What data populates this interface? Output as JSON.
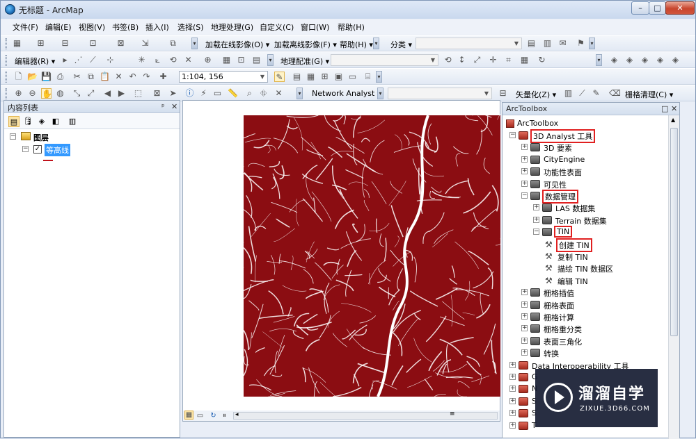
{
  "window": {
    "title": "无标题 - ArcMap",
    "minimize": "–",
    "maximize": "□",
    "close": "✕"
  },
  "menu": [
    "文件(F)",
    "编辑(E)",
    "视图(V)",
    "书签(B)",
    "插入(I)",
    "选择(S)",
    "地理处理(G)",
    "自定义(C)",
    "窗口(W)",
    "帮助(H)"
  ],
  "toolbar1": {
    "add_online_imagery": "加载在线影像(O) ▾",
    "add_offline_imagery": "加载离线影像(F) ▾",
    "help": "帮助(H) ▾",
    "classify": "分类 ▾"
  },
  "toolbar2": {
    "editor": "编辑器(R) ▾",
    "georeferencing": "地理配准(G) ▾"
  },
  "toolbar3": {
    "scale": "1:104, 156"
  },
  "toolbar4": {
    "network_analyst": "Network Analyst ▾",
    "vectorize": "矢量化(Z) ▾",
    "raster_cleanup": "栅格清理(C) ▾"
  },
  "toc": {
    "title": "内容列表",
    "pin": "ᵖ",
    "close": "✕",
    "root": "图层",
    "layer": "等高线"
  },
  "map": {
    "colors": {
      "contour_fill": "#8b0d12",
      "contour_line": "#ffffff"
    }
  },
  "toolbox": {
    "title": "ArcToolbox",
    "root": "ArcToolbox",
    "items": [
      {
        "label": "3D Analyst 工具",
        "level": 0,
        "expander": "−",
        "icon": "toolbox-icon",
        "highlight": true
      },
      {
        "label": "3D 要素",
        "level": 1,
        "expander": "+",
        "icon": "toolset-icon"
      },
      {
        "label": "CityEngine",
        "level": 1,
        "expander": "+",
        "icon": "toolset-icon"
      },
      {
        "label": "功能性表面",
        "level": 1,
        "expander": "+",
        "icon": "toolset-icon"
      },
      {
        "label": "可见性",
        "level": 1,
        "expander": "+",
        "icon": "toolset-icon"
      },
      {
        "label": "数据管理",
        "level": 1,
        "expander": "−",
        "icon": "toolset-icon",
        "highlight": true
      },
      {
        "label": "LAS 数据集",
        "level": 2,
        "expander": "+",
        "icon": "toolset-icon"
      },
      {
        "label": "Terrain 数据集",
        "level": 2,
        "expander": "+",
        "icon": "toolset-icon"
      },
      {
        "label": "TIN",
        "level": 2,
        "expander": "−",
        "icon": "toolset-icon",
        "highlight": true
      },
      {
        "label": "创建 TIN",
        "level": 3,
        "expander": "",
        "icon": "hammer-icon",
        "highlight": true
      },
      {
        "label": "复制 TIN",
        "level": 3,
        "expander": "",
        "icon": "hammer-icon"
      },
      {
        "label": "描绘 TIN 数据区",
        "level": 3,
        "expander": "",
        "icon": "hammer-icon"
      },
      {
        "label": "编辑 TIN",
        "level": 3,
        "expander": "",
        "icon": "hammer-icon"
      },
      {
        "label": "栅格插值",
        "level": 1,
        "expander": "+",
        "icon": "toolset-icon"
      },
      {
        "label": "栅格表面",
        "level": 1,
        "expander": "+",
        "icon": "toolset-icon"
      },
      {
        "label": "栅格计算",
        "level": 1,
        "expander": "+",
        "icon": "toolset-icon"
      },
      {
        "label": "栅格重分类",
        "level": 1,
        "expander": "+",
        "icon": "toolset-icon"
      },
      {
        "label": "表面三角化",
        "level": 1,
        "expander": "+",
        "icon": "toolset-icon"
      },
      {
        "label": "转换",
        "level": 1,
        "expander": "+",
        "icon": "toolset-icon"
      },
      {
        "label": "Data Interoperability 工具",
        "level": 0,
        "expander": "+",
        "icon": "toolbox-icon"
      },
      {
        "label": "G",
        "level": 0,
        "expander": "+",
        "icon": "toolbox-icon"
      },
      {
        "label": "N",
        "level": 0,
        "expander": "+",
        "icon": "toolbox-icon"
      },
      {
        "label": "S",
        "level": 0,
        "expander": "+",
        "icon": "toolbox-icon"
      },
      {
        "label": "S",
        "level": 0,
        "expander": "+",
        "icon": "toolbox-icon"
      },
      {
        "label": "T",
        "level": 0,
        "expander": "+",
        "icon": "toolbox-icon"
      }
    ]
  },
  "watermark": {
    "main": "溜溜自学",
    "sub": "ZIXUE.3D66.COM"
  }
}
